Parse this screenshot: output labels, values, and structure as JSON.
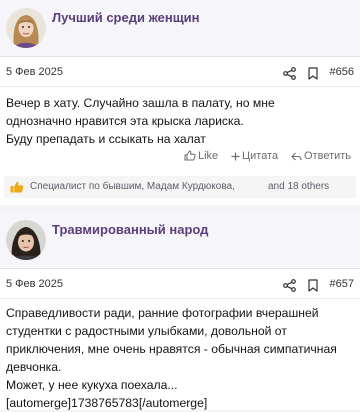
{
  "posts": [
    {
      "author": "Лучший среди женщин",
      "date": "5 Фев 2025",
      "number": "#656",
      "body": "Вечер в хату. Случайно зашла в палату, но мне\nоднозначно нравится эта крыска лариска.\nБуду препадать и ссыкать на халат",
      "actions": {
        "like": "Like",
        "quote": "Цитата",
        "reply": "Ответить"
      },
      "reactions": {
        "text": "Специалист по бывшим, Мадам Курдюкова,",
        "more": "and 18 others"
      }
    },
    {
      "author": "Травмированный народ",
      "date": "5 Фев 2025",
      "number": "#657",
      "body": "Справедливости ради, ранние фотографии вчерашней\nстудентки с радостными улыбками, довольной от\nприключения, мне очень нравятся - обычная симпатичная\nдевчонка.\nМожет, у нее кукуха поехала...\n[automerge]1738765783[/automerge]"
    }
  ],
  "colors": {
    "author_name": "#5a3e78",
    "author_bar": "#f6f5f9",
    "reaction_thumb": "#f0a81c"
  },
  "icons": [
    "share-icon",
    "bookmark-icon",
    "like-icon",
    "plus-icon",
    "reply-icon",
    "thumbs-up-icon"
  ]
}
